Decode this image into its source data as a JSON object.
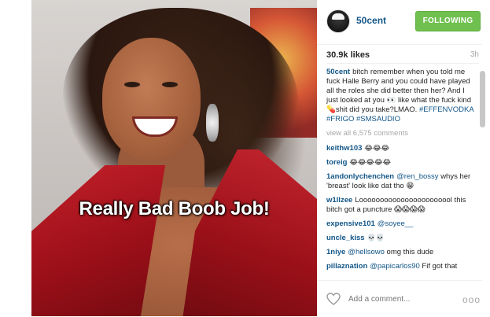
{
  "photo": {
    "overlay_text": "Really Bad Boob Job!"
  },
  "header": {
    "username": "50cent",
    "follow_button": "FOLLOWING"
  },
  "meta": {
    "likes": "30.9k likes",
    "time": "3h"
  },
  "caption": {
    "user": "50cent",
    "text": "bitch remember when you told me fuck Halle Berry and you could have played all the roles she did better then her? And I just looked at you 👀 like what the fuck kind 💊shit did you take?LMAO.",
    "hashtags": "#EFFENVODKA #FRIGO #SMSAUDIO"
  },
  "view_all": "view all 6,575 comments",
  "comments": [
    {
      "user": "keithw103",
      "text": "😂😂😂"
    },
    {
      "user": "toreig",
      "text": "😂😂😂😂😂"
    },
    {
      "user": "1andonlychenchen",
      "mention": "@ren_bossy",
      "text": "whys her 'breast' look like dat tho 😁"
    },
    {
      "user": "w1llzee",
      "text": "Looooooooooooooooooooool this bitch got a puncture 😱😱😱😱"
    },
    {
      "user": "expensive101",
      "mention": "@soyee__",
      "text": ""
    },
    {
      "user": "uncle_kiss",
      "text": "💀💀"
    },
    {
      "user": "1niye",
      "mention": "@hellsowo",
      "text": "omg this dude"
    },
    {
      "user": "pillaznation",
      "mention": "@papicarlos90",
      "text": "Fif got that"
    }
  ],
  "footer": {
    "add_comment_placeholder": "Add a comment...",
    "more_label": "ooo"
  },
  "colors": {
    "link_blue": "#125688",
    "follow_green": "#70c050",
    "muted_gray": "#a5a7aa"
  },
  "icons": {
    "like": "heart-icon",
    "options": "more-options-icon"
  }
}
